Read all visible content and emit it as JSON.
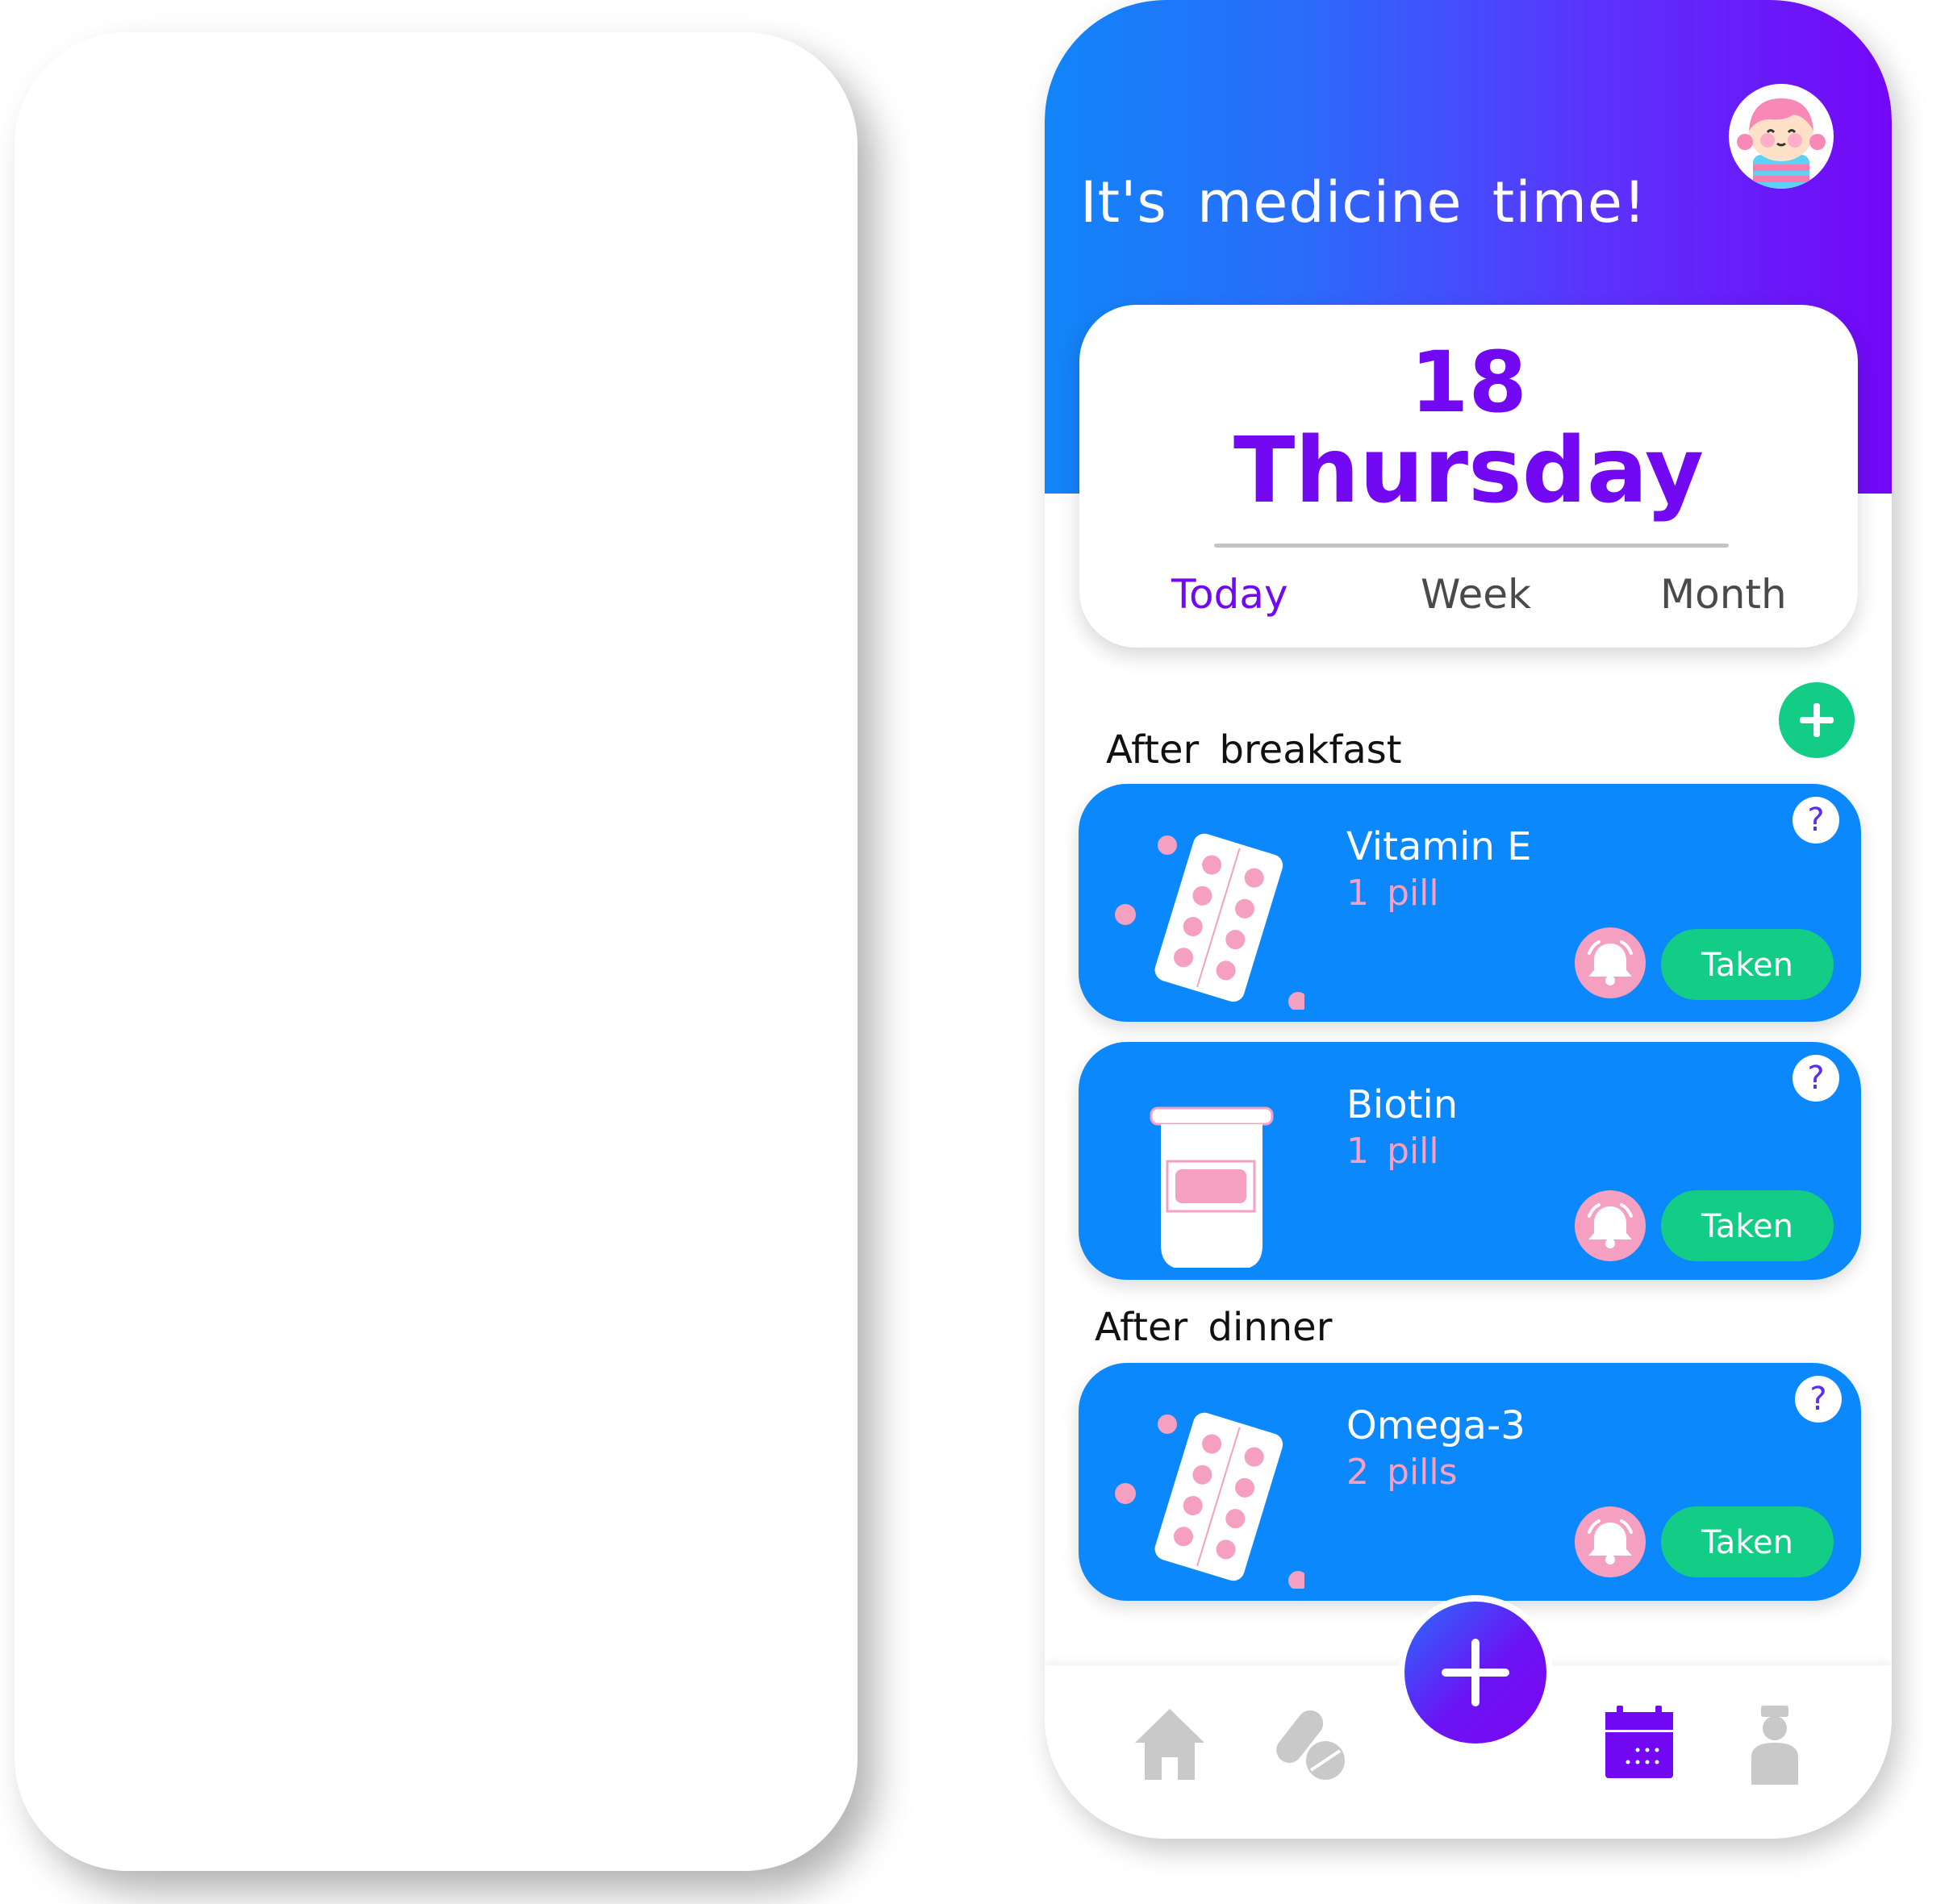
{
  "header": {
    "title": "It's medicine time!"
  },
  "date_card": {
    "day_number": "18",
    "weekday": "Thursday",
    "tabs": [
      {
        "label": "Today",
        "active": true
      },
      {
        "label": "Week",
        "active": false
      },
      {
        "label": "Month",
        "active": false
      }
    ]
  },
  "sections": [
    {
      "label": "After breakfast",
      "items": [
        {
          "name": "Vitamin E",
          "dose": "1 pill",
          "button": "Taken",
          "help": "?"
        },
        {
          "name": "Biotin",
          "dose": "1 pill",
          "button": "Taken",
          "help": "?"
        }
      ]
    },
    {
      "label": "After dinner",
      "items": [
        {
          "name": "Omega-3",
          "dose": "2 pills",
          "button": "Taken",
          "help": "?"
        }
      ]
    }
  ],
  "nav": {
    "items": [
      "home-icon",
      "pills-icon",
      "add-icon",
      "calendar-icon",
      "doctor-icon"
    ],
    "active": "calendar-icon"
  },
  "colors": {
    "header_start": "#1185f8",
    "header_end": "#7407f7",
    "accent_purple": "#7209f2",
    "card_blue": "#0b88fc",
    "taken_green": "#13cc86",
    "pink": "#f59fc1"
  }
}
